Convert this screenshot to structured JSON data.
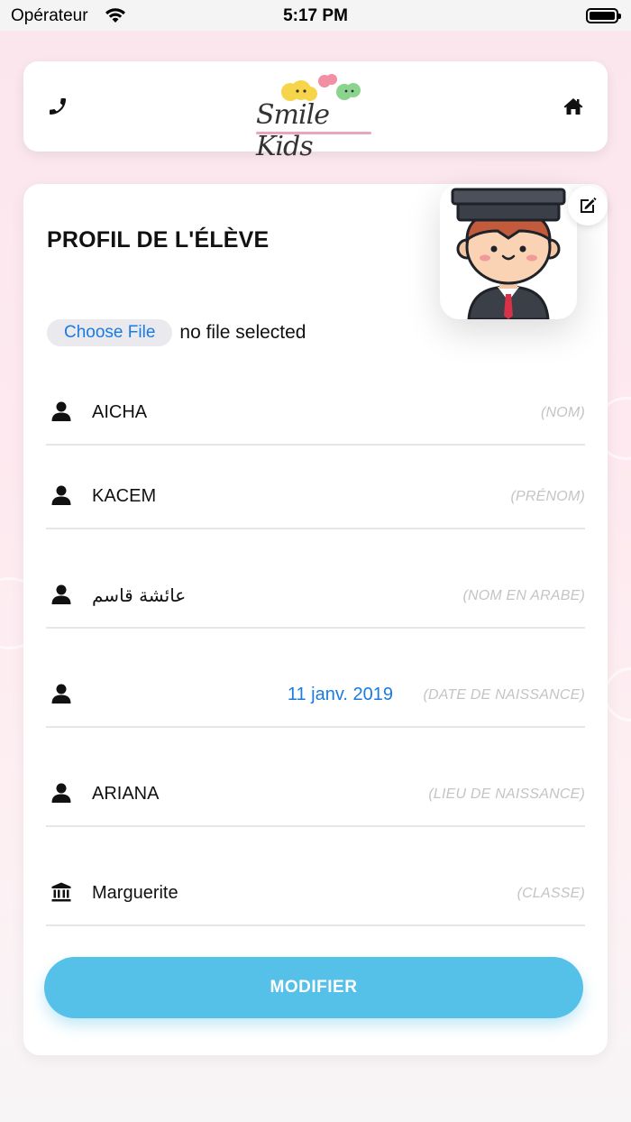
{
  "status_bar": {
    "carrier": "Opérateur",
    "time": "5:17 PM",
    "battery_level": 0.95
  },
  "header": {
    "phone_icon": "phone-icon",
    "logo_text": "Smile Kids",
    "home_icon": "home-icon"
  },
  "profile": {
    "title": "PROFIL DE L'ÉLÈVE",
    "avatar_icon": "student-graduate-avatar",
    "edit_icon": "edit-icon",
    "file_button_label": "Choose File",
    "file_status": "no file selected"
  },
  "fields": {
    "nom": {
      "value": "AICHA",
      "label": "(NOM)",
      "icon": "user-icon"
    },
    "prenom": {
      "value": "KACEM",
      "label": "(PRÉNOM)",
      "icon": "user-icon"
    },
    "nom_arabe": {
      "value": "عائشة قاسم",
      "label": "(NOM EN ARABE)",
      "icon": "user-icon"
    },
    "date_naissance": {
      "value": "11 janv. 2019",
      "label": "(DATE DE NAISSANCE)",
      "icon": "user-icon"
    },
    "lieu_naissance": {
      "value": "ARIANA",
      "label": "(LIEU DE NAISSANCE)",
      "icon": "user-icon"
    },
    "classe": {
      "value": "Marguerite",
      "label": "(CLASSE)",
      "icon": "school-building-icon"
    }
  },
  "actions": {
    "submit_label": "MODIFIER"
  },
  "colors": {
    "accent": "#55c1e8",
    "link_blue": "#1a7be2",
    "background_pink": "#fbe6ee"
  }
}
